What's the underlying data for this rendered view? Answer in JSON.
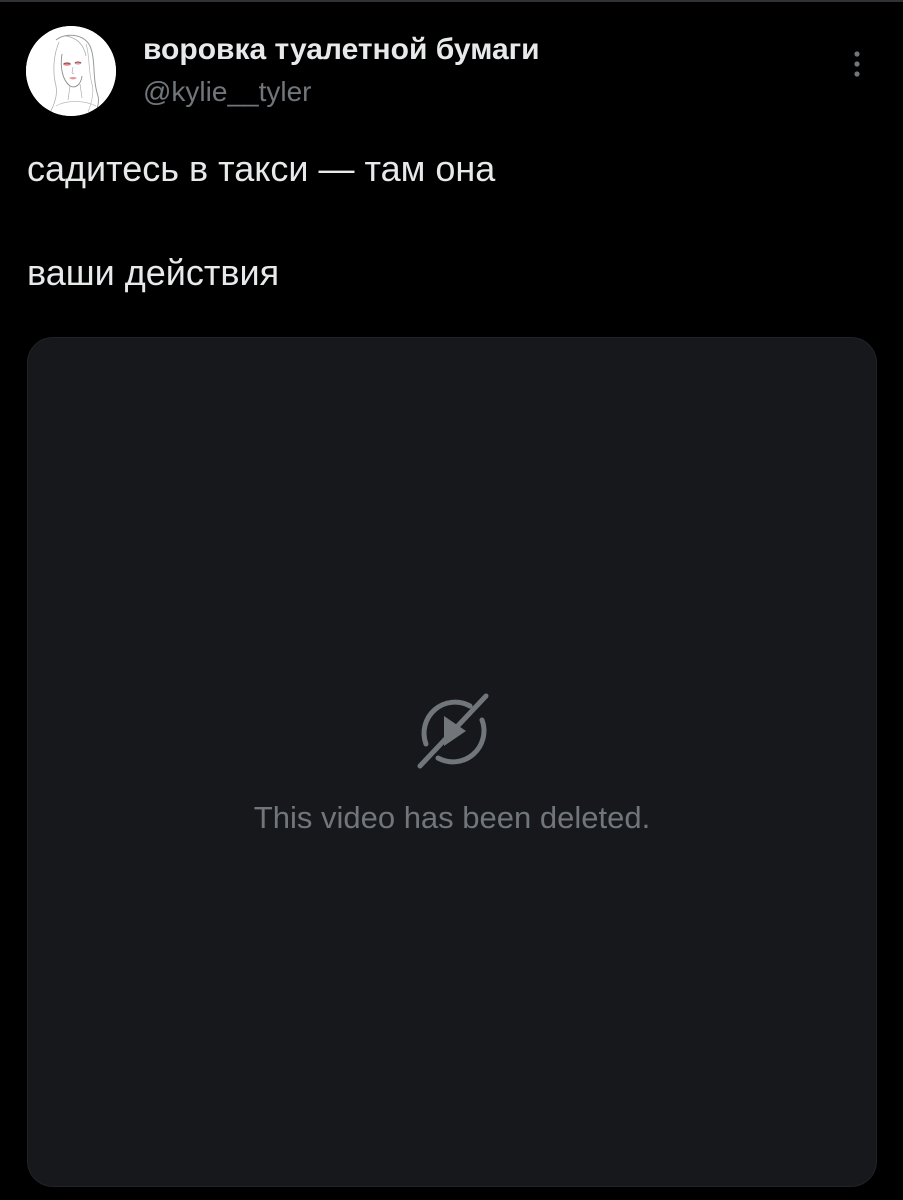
{
  "tweet": {
    "author": {
      "display_name": "воровка туалетной бумаги",
      "handle": "@kylie__tyler",
      "avatar_icon": "avatar-sketch-portrait"
    },
    "more_icon": "vertical-ellipsis-icon",
    "text_lines": [
      "садитесь в такси — там она",
      "ваши действия"
    ],
    "media": {
      "type": "video",
      "status_icon": "video-deleted-icon",
      "status_message": "This video has been deleted."
    }
  },
  "colors": {
    "background": "#000000",
    "primary_text": "#e7e9ea",
    "secondary_text": "#71767b",
    "media_background": "#16181c",
    "icon_gray": "#71767b"
  }
}
